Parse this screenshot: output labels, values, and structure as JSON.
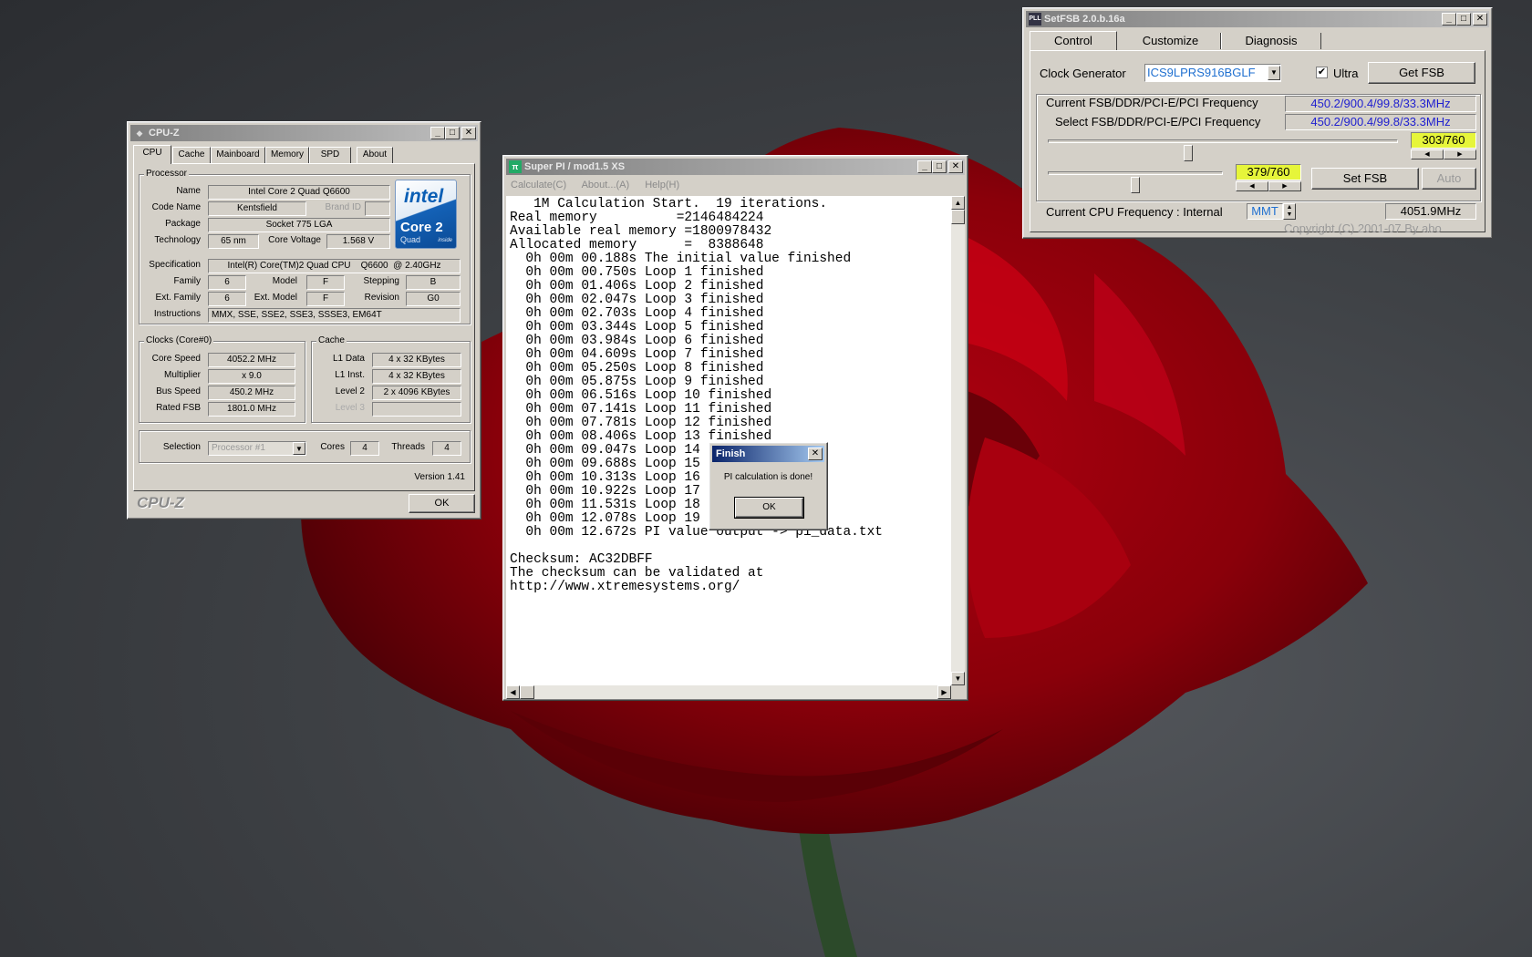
{
  "cpuz": {
    "title": "CPU-Z",
    "tabs": [
      "CPU",
      "Cache",
      "Mainboard",
      "Memory",
      "SPD",
      "About"
    ],
    "processor_group": "Processor",
    "labels": {
      "name": "Name",
      "code_name": "Code Name",
      "brand_id": "Brand ID",
      "package": "Package",
      "technology": "Technology",
      "core_voltage": "Core Voltage",
      "specification": "Specification",
      "family": "Family",
      "model": "Model",
      "stepping": "Stepping",
      "ext_family": "Ext. Family",
      "ext_model": "Ext. Model",
      "revision": "Revision",
      "instructions": "Instructions"
    },
    "values": {
      "name": "Intel Core 2 Quad Q6600",
      "code_name": "Kentsfield",
      "package": "Socket 775 LGA",
      "technology": "65 nm",
      "core_voltage": "1.568 V",
      "specification": "Intel(R) Core(TM)2 Quad CPU    Q6600  @ 2.40GHz",
      "family": "6",
      "model": "F",
      "stepping": "B",
      "ext_family": "6",
      "ext_model": "F",
      "revision": "G0",
      "instructions": "MMX, SSE, SSE2, SSE3, SSSE3, EM64T"
    },
    "logo": {
      "brand": "intel",
      "line1": "Core 2",
      "line2": "Quad",
      "badge": "inside"
    },
    "clocks_group": "Clocks (Core#0)",
    "clocks": [
      {
        "label": "Core Speed",
        "value": "4052.2 MHz"
      },
      {
        "label": "Multiplier",
        "value": "x 9.0"
      },
      {
        "label": "Bus Speed",
        "value": "450.2 MHz"
      },
      {
        "label": "Rated FSB",
        "value": "1801.0 MHz"
      }
    ],
    "cache_group": "Cache",
    "cache": [
      {
        "label": "L1 Data",
        "value": "4 x 32 KBytes"
      },
      {
        "label": "L1 Inst.",
        "value": "4 x 32 KBytes"
      },
      {
        "label": "Level 2",
        "value": "2 x 4096 KBytes"
      },
      {
        "label": "Level 3",
        "value": ""
      }
    ],
    "selection_label": "Selection",
    "selection_value": "Processor #1",
    "cores_label": "Cores",
    "cores_value": "4",
    "threads_label": "Threads",
    "threads_value": "4",
    "version": "Version 1.41",
    "brand": "CPU-Z",
    "ok": "OK"
  },
  "superpi": {
    "title": "Super PI / mod1.5 XS",
    "menu": [
      "Calculate(C)",
      "About...(A)",
      "Help(H)"
    ],
    "lines": [
      "   1M Calculation Start.  19 iterations.",
      "Real memory          =2146484224",
      "Available real memory =1800978432",
      "Allocated memory      =  8388648",
      "  0h 00m 00.188s The initial value finished",
      "  0h 00m 00.750s Loop 1 finished",
      "  0h 00m 01.406s Loop 2 finished",
      "  0h 00m 02.047s Loop 3 finished",
      "  0h 00m 02.703s Loop 4 finished",
      "  0h 00m 03.344s Loop 5 finished",
      "  0h 00m 03.984s Loop 6 finished",
      "  0h 00m 04.609s Loop 7 finished",
      "  0h 00m 05.250s Loop 8 finished",
      "  0h 00m 05.875s Loop 9 finished",
      "  0h 00m 06.516s Loop 10 finished",
      "  0h 00m 07.141s Loop 11 finished",
      "  0h 00m 07.781s Loop 12 finished",
      "  0h 00m 08.406s Loop 13 finished",
      "  0h 00m 09.047s Loop 14 finished",
      "  0h 00m 09.688s Loop 15 finished",
      "  0h 00m 10.313s Loop 16 finished",
      "  0h 00m 10.922s Loop 17 finished",
      "  0h 00m 11.531s Loop 18 finished",
      "  0h 00m 12.078s Loop 19 finished",
      "  0h 00m 12.672s PI value output -> pi_data.txt",
      "",
      "Checksum: AC32DBFF",
      "The checksum can be validated at",
      "http://www.xtremesystems.org/"
    ]
  },
  "finish_dialog": {
    "title": "Finish",
    "message": "PI calculation is done!",
    "ok": "OK"
  },
  "setfsb": {
    "title": "SetFSB 2.0.b.16a",
    "tabs": [
      "Control",
      "Customize",
      "Diagnosis"
    ],
    "clock_gen_label": "Clock Generator",
    "clock_gen_value": "ICS9LPRS916BGLF",
    "ultra_label": "Ultra",
    "ultra_checked": true,
    "get_fsb": "Get FSB",
    "current_label": "Current FSB/DDR/PCI-E/PCI Frequency",
    "current_value": "450.2/900.4/99.8/33.3MHz",
    "select_label": "Select FSB/DDR/PCI-E/PCI Frequency",
    "select_value": "450.2/900.4/99.8/33.3MHz",
    "slider1_value": "303/760",
    "slider1_fraction": 0.4,
    "slider2_value": "379/760",
    "slider2_fraction": 0.5,
    "set_fsb": "Set FSB",
    "auto": "Auto",
    "cpu_freq_label": "Current CPU Frequency : Internal",
    "cpu_freq_source": "MMT",
    "cpu_freq_value": "4051.9MHz",
    "copyright": "Copyright (C) 2001-07 By abo"
  }
}
